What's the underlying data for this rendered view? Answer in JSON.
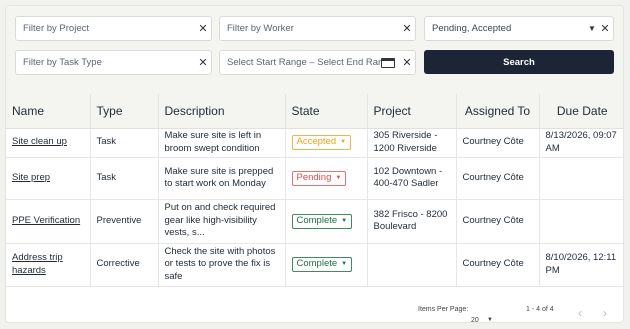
{
  "filters": {
    "project_placeholder": "Filter by Project",
    "worker_placeholder": "Filter by Worker",
    "state_value": "Pending, Accepted",
    "task_type_placeholder": "Filter by Task Type",
    "date_range_placeholder": "Select Start Range – Select End Range",
    "search_label": "Search"
  },
  "table": {
    "headers": {
      "name": "Name",
      "type": "Type",
      "description": "Description",
      "state": "State",
      "project": "Project",
      "assigned_to": "Assigned To",
      "due_date": "Due Date"
    },
    "rows": [
      {
        "name": "Site clean up",
        "type": "Task",
        "description": "Make sure site is left in broom swept condition",
        "state": "Accepted",
        "project": "305 Riverside - 1200 Riverside",
        "assigned_to": "Courtney Côte",
        "due_date": "8/13/2026, 09:07 AM"
      },
      {
        "name": "Site prep",
        "type": "Task",
        "description": "Make sure site is prepped to start work on Monday",
        "state": "Pending",
        "project": "102 Downtown - 400-470 Sadler",
        "assigned_to": "Courtney Côte",
        "due_date": ""
      },
      {
        "name": "PPE Verification",
        "type": "Preventive",
        "description": "Put on and check required gear like high-visibility vests, s...",
        "state": "Complete",
        "project": "382 Frisco - 8200 Boulevard",
        "assigned_to": "Courtney Côte",
        "due_date": ""
      },
      {
        "name": "Address trip hazards",
        "type": "Corrective",
        "description": "Check the site with photos or tests to prove the fix is safe",
        "state": "Complete",
        "project": "",
        "assigned_to": "Courtney Côte",
        "due_date": "8/10/2026, 12:11 PM"
      }
    ]
  },
  "pagination": {
    "items_per_page_label": "Items Per Page:",
    "items_per_page_value": "20",
    "range_text": "1 - 4 of 4"
  },
  "colors": {
    "accepted": "#f0a020",
    "pending": "#e24a4a",
    "complete": "#1f6e46",
    "search_button": "#1c2536"
  }
}
